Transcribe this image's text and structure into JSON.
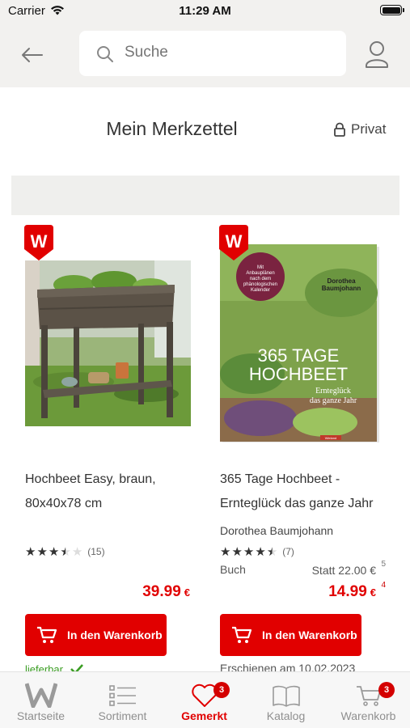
{
  "status_bar": {
    "carrier": "Carrier",
    "time": "11:29 AM"
  },
  "header": {
    "search_placeholder": "Suche"
  },
  "page": {
    "title": "Mein Merkzettel",
    "privacy_label": "Privat"
  },
  "products": [
    {
      "name": "Hochbeet Easy, braun, 80x40x78 cm",
      "rating": 3.5,
      "stars_text": "★★★★★",
      "review_count": "(15)",
      "price": "39.99",
      "currency": "€",
      "cart_label": "In den Warenkorb",
      "availability": "lieferbar",
      "badge_letter": "W"
    },
    {
      "name": "365 Tage Hochbeet - Ernteglück das ganze Jahr",
      "author": "Dorothea Baumjohann",
      "rating": 4.5,
      "stars_text": "★★★★★",
      "review_count": "(7)",
      "type": "Buch",
      "old_price": "Statt 22.00 €",
      "old_price_footnote": "5",
      "price": "14.99",
      "currency": "€",
      "price_footnote": "4",
      "cart_label": "In den Warenkorb",
      "release": "Erschienen am 10.02.2023",
      "badge_letter": "W",
      "book_cover": {
        "banner": "Mit Anbauplänen nach dem phänologischen Kalender",
        "author": "Dorothea Baumjohann",
        "title_line1": "365 TAGE",
        "title_line2": "HOCHBEET",
        "subtitle_line1": "Ernteglück",
        "subtitle_line2": "das ganze Jahr",
        "publisher": "Wieland"
      }
    }
  ],
  "tabs": [
    {
      "label": "Startseite",
      "icon": "w-logo-icon",
      "active": false
    },
    {
      "label": "Sortiment",
      "icon": "list-icon",
      "active": false
    },
    {
      "label": "Gemerkt",
      "icon": "heart-icon",
      "active": true,
      "badge": "3"
    },
    {
      "label": "Katalog",
      "icon": "book-icon",
      "active": false
    },
    {
      "label": "Warenkorb",
      "icon": "cart-icon",
      "active": false,
      "badge": "3"
    }
  ],
  "colors": {
    "brand_red": "#e10000",
    "header_bg": "#f2f1ef",
    "available_green": "#3a9d23"
  }
}
